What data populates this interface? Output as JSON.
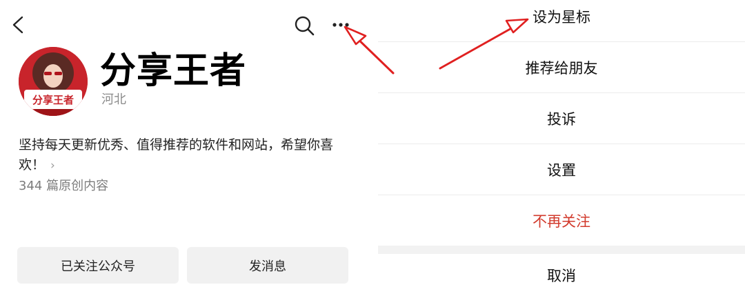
{
  "profile": {
    "name": "分享王者",
    "region": "河北",
    "bio": "坚持每天更新优秀、值得推荐的软件和网站，希望你喜欢！",
    "article_count": "344 篇原创内容",
    "avatar_text": "分享王者"
  },
  "actions": {
    "follow_label": "已关注公众号",
    "message_label": "发消息"
  },
  "menu": {
    "items": [
      {
        "label": "设为星标"
      },
      {
        "label": "推荐给朋友"
      },
      {
        "label": "投诉"
      },
      {
        "label": "设置"
      },
      {
        "label": "不再关注",
        "color": "#d23a2c"
      }
    ],
    "cancel_label": "取消"
  },
  "icons": {
    "back": "chevron-left-icon",
    "search": "search-icon",
    "more": "more-dots-icon",
    "annotation": "red-arrow"
  },
  "colors": {
    "danger": "#d23a2c",
    "annotation": "#e02020"
  }
}
